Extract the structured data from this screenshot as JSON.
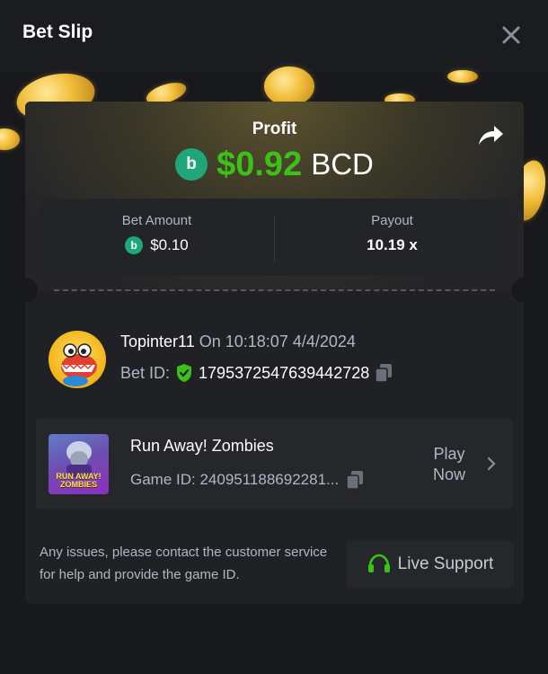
{
  "header": {
    "title": "Bet Slip"
  },
  "profit": {
    "label": "Profit",
    "amount": "$0.92",
    "currency": "BCD",
    "amount_color": "#3bc117"
  },
  "stats": {
    "bet_amount_label": "Bet Amount",
    "bet_amount_value": "$0.10",
    "payout_label": "Payout",
    "payout_value": "10.19 x"
  },
  "user": {
    "name": "Topinter11",
    "on_text": "On 10:18:07 4/4/2024",
    "bet_id_label": "Bet ID:",
    "bet_id": "1795372547639442728"
  },
  "game": {
    "name": "Run Away! Zombies",
    "game_id": "Game ID: 240951188692281...",
    "thumb_title_line1": "RUN AWAY!",
    "thumb_title_line2": "ZOMBIES",
    "play_now": "Play Now"
  },
  "footer": {
    "notice": "Any issues, please contact the customer service for help and provide the game ID.",
    "live_support": "Live Support"
  },
  "icons": {
    "close": "close-icon",
    "share": "share-icon",
    "currency": "bcd-coin-icon",
    "verified": "shield-check-icon",
    "copy": "copy-icon",
    "chevron": "chevron-right-icon",
    "headset": "headset-icon"
  },
  "colors": {
    "background": "#18191c",
    "card": "#202125",
    "accent_green": "#3bc117",
    "bcd_green": "#1fa77a",
    "muted_text": "#b1b6c6"
  }
}
